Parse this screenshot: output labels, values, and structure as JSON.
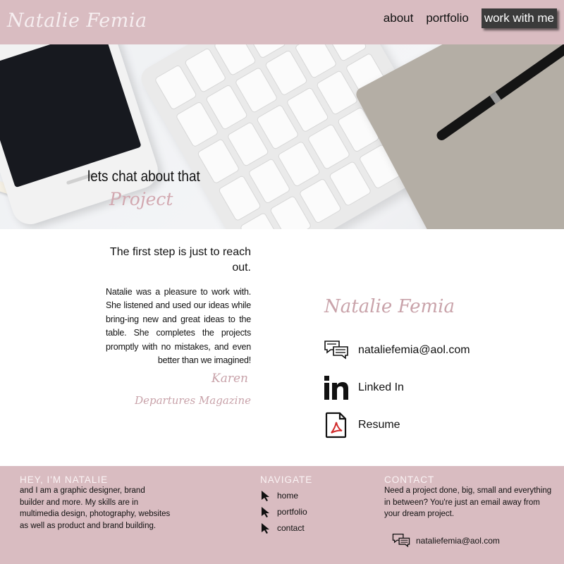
{
  "header": {
    "logo": "Natalie Femia",
    "nav": [
      {
        "label": "about"
      },
      {
        "label": "portfolio"
      },
      {
        "label": "work with me"
      }
    ]
  },
  "hero": {
    "line1": "lets chat about that",
    "line2": "Project"
  },
  "testimonial": {
    "heading": "The first step is just to reach out.",
    "body": "Natalie was a pleasure to work with. She listened and used our ideas while bring-ing new and great ideas to the table. She completes the projects promptly with no mistakes, and even better than we imagined!",
    "author": "Karen",
    "organization": "Departures Magazine"
  },
  "contact_card": {
    "name": "Natalie Femia",
    "items": [
      {
        "icon": "chat-bubbles-icon",
        "label": "nataliefemia@aol.com"
      },
      {
        "icon": "linkedin-icon",
        "label": "Linked In"
      },
      {
        "icon": "pdf-file-icon",
        "label": "Resume"
      }
    ]
  },
  "footer": {
    "about": {
      "title": "HEY, I'M NATALIE",
      "text": "and I am a graphic designer, brand builder and more. My skills are in multimedia design, photography, websites as well as product and brand building."
    },
    "navigate": {
      "title": "NAVIGATE",
      "items": [
        "home",
        "portfolio",
        "contact"
      ]
    },
    "contact": {
      "title": "CONTACT",
      "text": "Need a project done, big, small and everything in between? You're just an email away from your dream project.",
      "email": "nataliefemia@aol.com"
    }
  },
  "colors": {
    "brand_pink": "#d9bcc1",
    "script_pink": "#c9a3aa",
    "cta_dark": "#3b3b3b"
  }
}
